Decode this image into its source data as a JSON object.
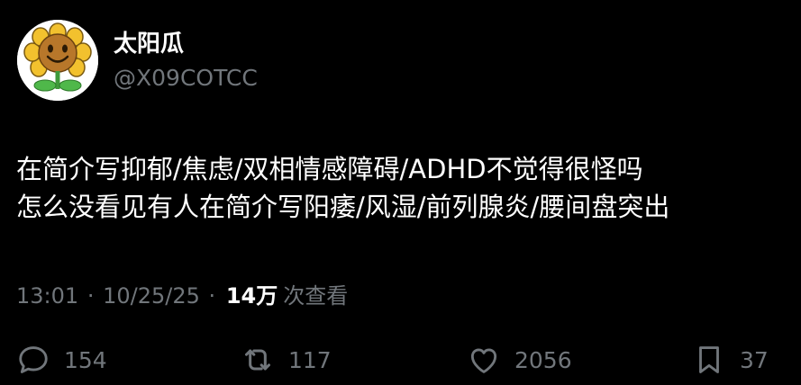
{
  "tweet": {
    "author": {
      "display_name": "太阳瓜",
      "handle": "@X09COTCC"
    },
    "text_lines": [
      "在简介写抑郁/焦虑/双相情感障碍/ADHD不觉得很怪吗",
      "怎么没看见有人在简介写阳痿/风湿/前列腺炎/腰间盘突出"
    ],
    "meta": {
      "time": "13:01",
      "separator": "·",
      "date": "10/25/25",
      "views_count": "14万",
      "views_label": "次查看"
    },
    "actions": {
      "replies": "154",
      "retweets": "117",
      "likes": "2056",
      "bookmarks": "37"
    }
  },
  "icons": {
    "avatar": "sunflower-avatar-icon",
    "reply": "reply-bubble-icon",
    "retweet": "retweet-arrows-icon",
    "like": "heart-icon",
    "bookmark": "bookmark-icon"
  },
  "colors": {
    "background": "#000000",
    "primary_text": "#ffffff",
    "secondary_text": "#71767b"
  }
}
